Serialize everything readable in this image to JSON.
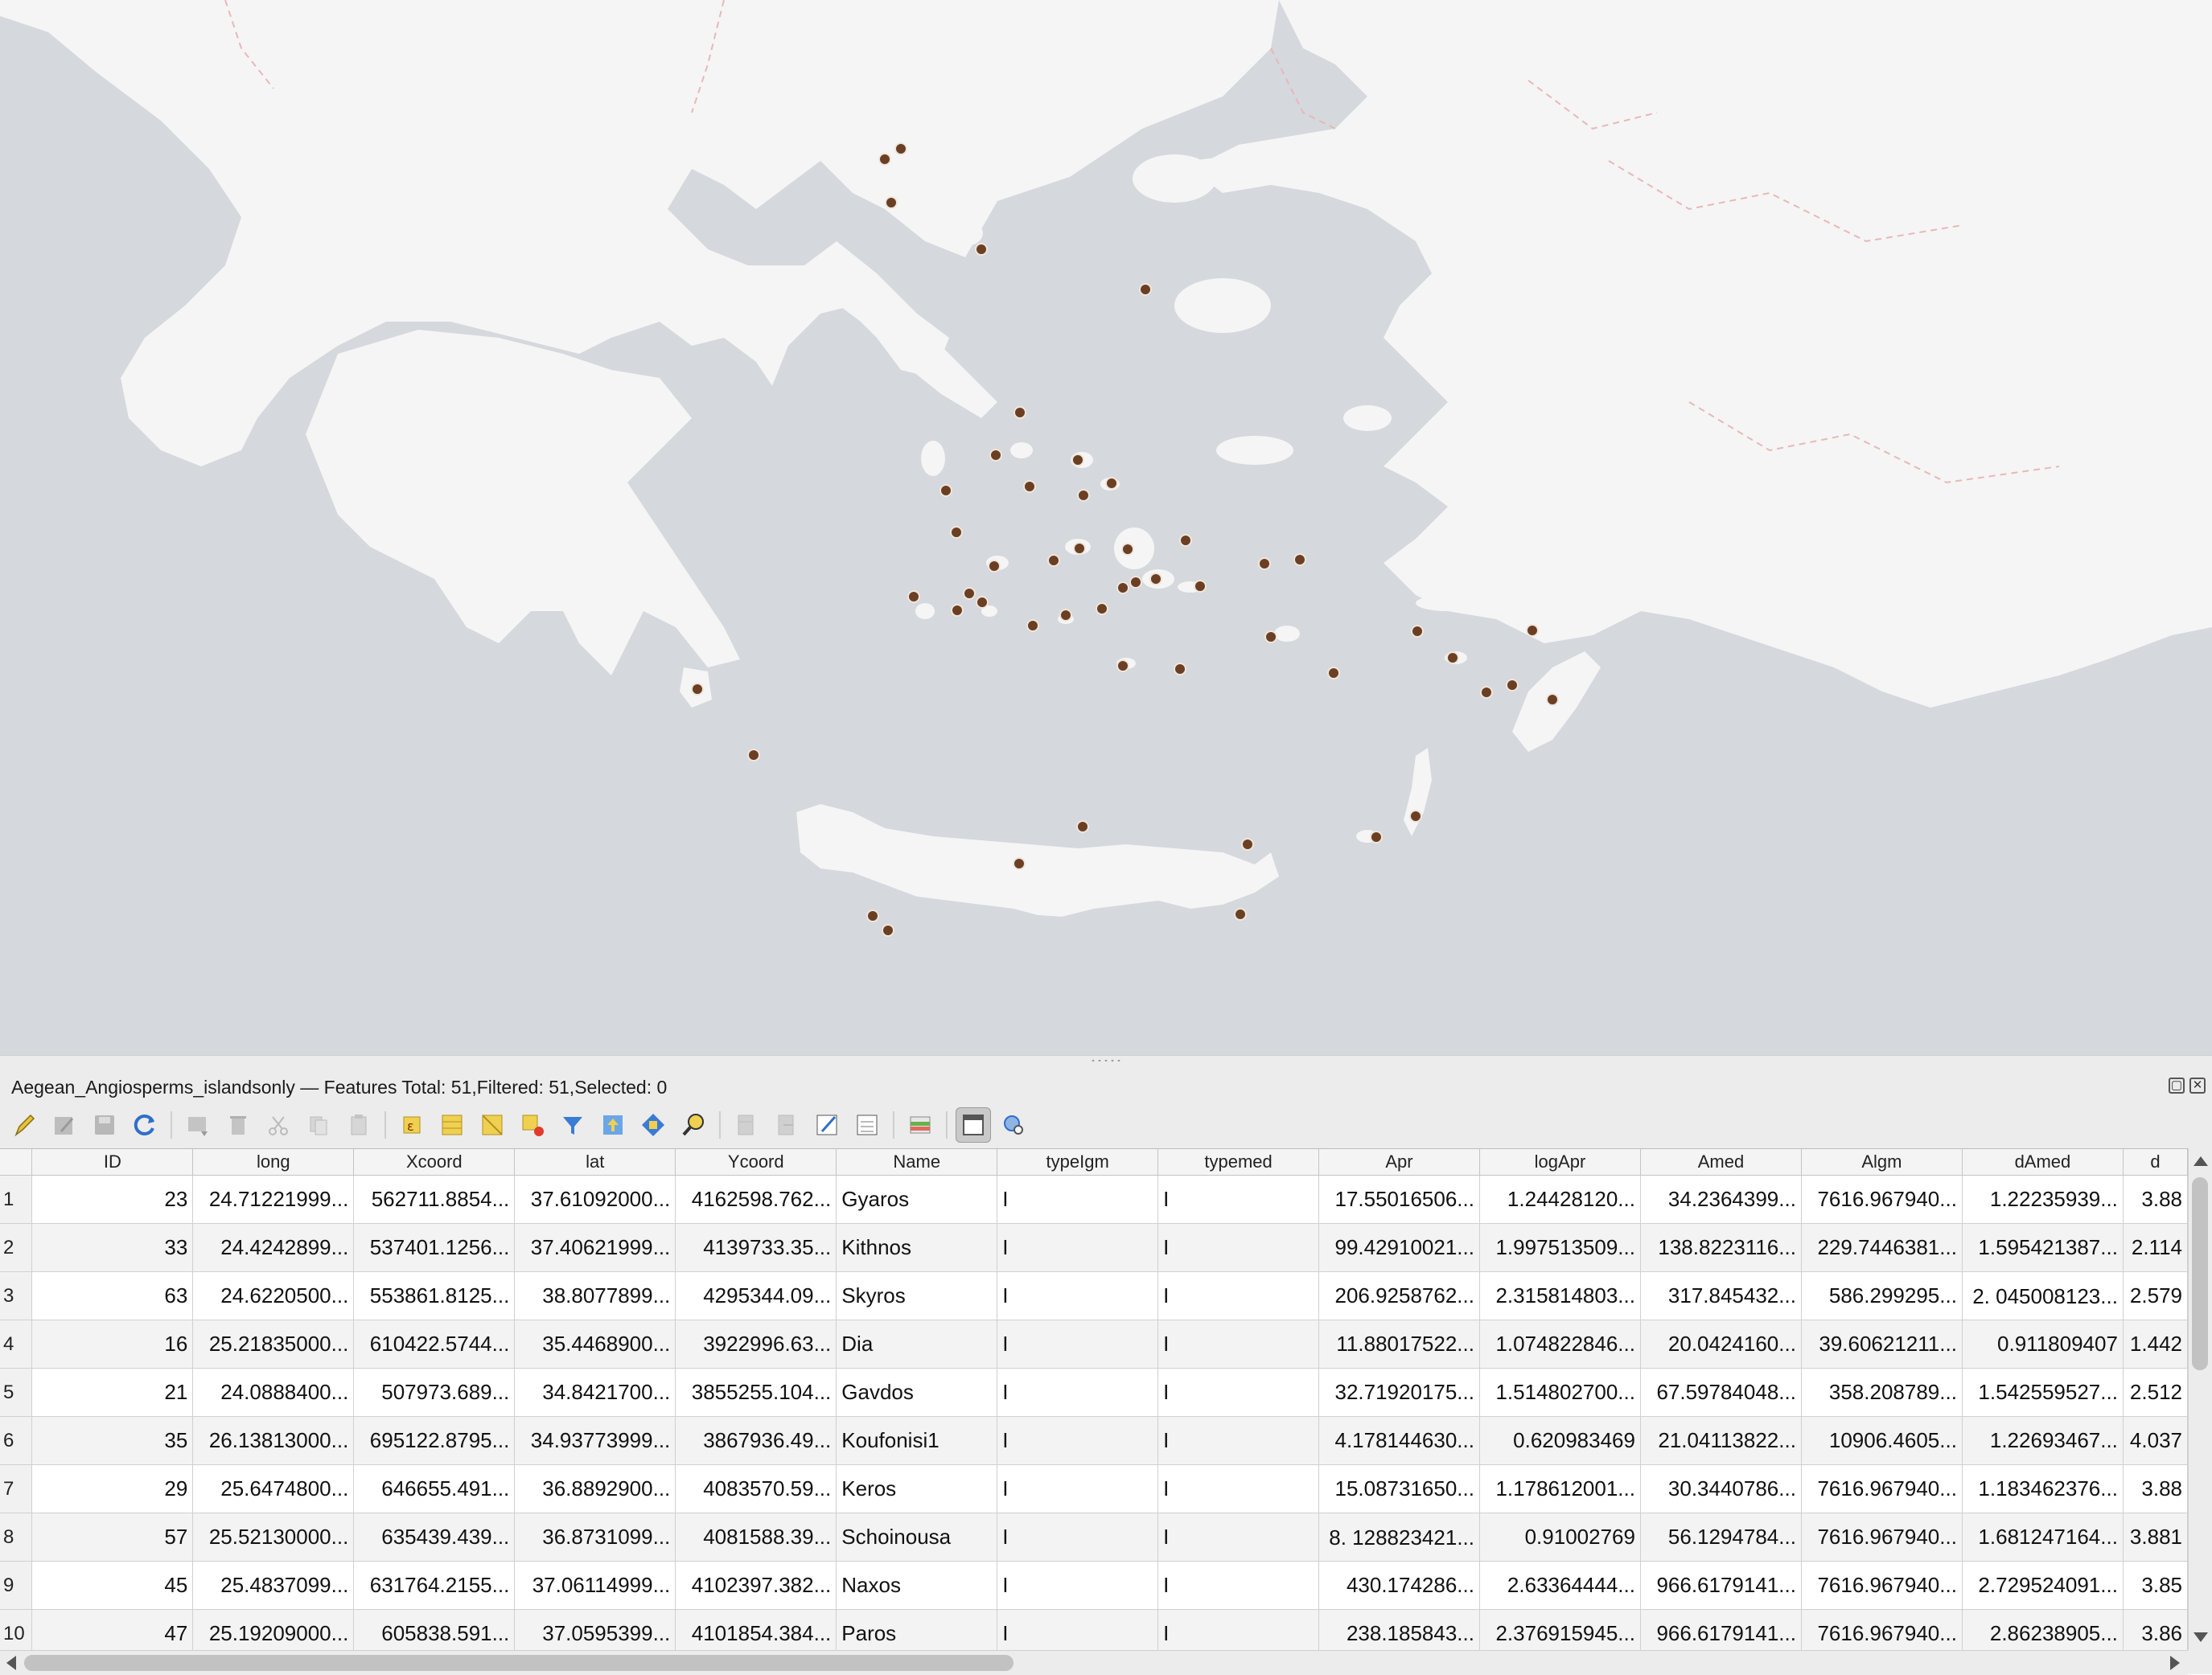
{
  "layer": {
    "title": "Aegean_Angiosperms_islandsonly — Features Total: 51,Filtered: 51,Selected: 0"
  },
  "colors": {
    "sea": "#d5d8dc",
    "land": "#f5f5f5",
    "point_fill": "#6b3f24",
    "point_stroke": "#f0e6dc",
    "border": "#e8b8b8"
  },
  "toolbar_icons": [
    "toggle-editing-icon",
    "multi-edit-icon",
    "save-edits-icon",
    "reload-table-icon",
    "add-feature-icon",
    "delete-feature-icon",
    "cut-icon",
    "copy-icon",
    "paste-icon",
    "select-by-expression-icon",
    "select-all-icon",
    "invert-selection-icon",
    "deselect-all-icon",
    "filter-select-icon",
    "move-selection-top-icon",
    "pan-to-selection-icon",
    "zoom-to-selection-icon",
    "new-field-icon",
    "delete-field-icon",
    "organize-columns-icon",
    "field-calculator-icon",
    "conditional-formatting-icon",
    "dock-table-icon",
    "actions-icon"
  ],
  "table": {
    "columns": [
      "ID",
      "long",
      "Xcoord",
      "lat",
      "Ycoord",
      "Name",
      "typeIgm",
      "typemed",
      "Apr",
      "logApr",
      "Amed",
      "Algm",
      "dAmed",
      "d"
    ],
    "rows": [
      [
        "1",
        "23",
        "24.71221999...",
        "562711.8854...",
        "37.61092000...",
        "4162598.762...",
        "Gyaros",
        "I",
        "I",
        "17.55016506...",
        "1.24428120...",
        "34.2364399...",
        "7616.967940...",
        "1.22235939...",
        "3.88"
      ],
      [
        "2",
        "33",
        "24.4242899...",
        "537401.1256...",
        "37.40621999...",
        "4139733.35...",
        "Kithnos",
        "I",
        "I",
        "99.42910021...",
        "1.997513509...",
        "138.8223116...",
        "229.7446381...",
        "1.595421387...",
        "2.114"
      ],
      [
        "3",
        "63",
        "24.6220500...",
        "553861.8125...",
        "38.8077899...",
        "4295344.09...",
        "Skyros",
        "I",
        "I",
        "206.9258762...",
        "2.315814803...",
        "317.845432...",
        "586.299295...",
        "2. 045008123...",
        "2.579"
      ],
      [
        "4",
        "16",
        "25.21835000...",
        "610422.5744...",
        "35.4468900...",
        "3922996.63...",
        "Dia",
        "I",
        "I",
        "11.88017522...",
        "1.074822846...",
        "20.0424160...",
        "39.60621211...",
        "0.911809407",
        "1.442"
      ],
      [
        "5",
        "21",
        "24.0888400...",
        "507973.689...",
        "34.8421700...",
        "3855255.104...",
        "Gavdos",
        "I",
        "I",
        "32.71920175...",
        "1.514802700...",
        "67.59784048...",
        "358.208789...",
        "1.542559527...",
        "2.512"
      ],
      [
        "6",
        "35",
        "26.13813000...",
        "695122.8795...",
        "34.93773999...",
        "3867936.49...",
        "Koufonisi1",
        "I",
        "I",
        "4.178144630...",
        "0.620983469",
        "21.04113822...",
        "10906.4605...",
        "1.22693467...",
        "4.037"
      ],
      [
        "7",
        "29",
        "25.6474800...",
        "646655.491...",
        "36.8892900...",
        "4083570.59...",
        "Keros",
        "I",
        "I",
        "15.08731650...",
        "1.178612001...",
        "30.3440786...",
        "7616.967940...",
        "1.183462376...",
        "3.88"
      ],
      [
        "8",
        "57",
        "25.52130000...",
        "635439.439...",
        "36.8731099...",
        "4081588.39...",
        "Schoinousa",
        "I",
        "I",
        "8. 128823421...",
        "0.91002769",
        "56.1294784...",
        "7616.967940...",
        "1.681247164...",
        "3.881"
      ],
      [
        "9",
        "45",
        "25.4837099...",
        "631764.2155...",
        "37.06114999...",
        "4102397.382...",
        "Naxos",
        "I",
        "I",
        "430.174286...",
        "2.63364444...",
        "966.6179141...",
        "7616.967940...",
        "2.729524091...",
        "3.85"
      ],
      [
        "10",
        "47",
        "25.19209000...",
        "605838.591...",
        "37.0595399...",
        "4101854.384...",
        "Paros",
        "I",
        "I",
        "238.185843...",
        "2.376915945...",
        "966.6179141...",
        "7616.967940...",
        "2.86238905...",
        "3.86"
      ]
    ]
  }
}
